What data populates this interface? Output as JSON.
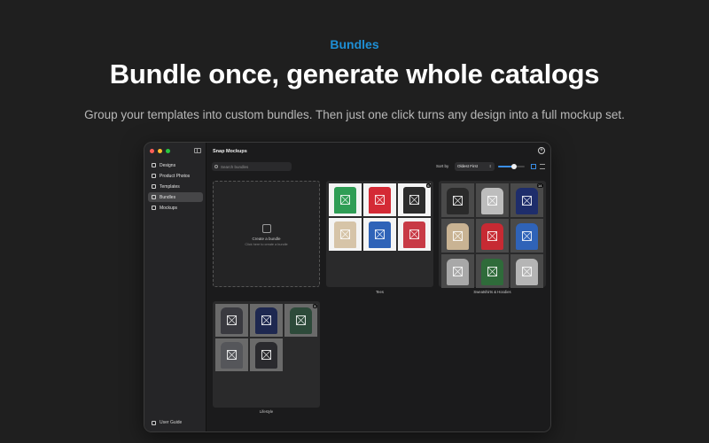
{
  "hero": {
    "eyebrow": "Bundles",
    "headline": "Bundle once, generate whole catalogs",
    "subline": "Group your templates into custom bundles. Then just one click turns any design into a full mockup set."
  },
  "window": {
    "title": "Snap Mockups",
    "add_icon": "plus-circle-icon"
  },
  "sidebar": {
    "items": [
      {
        "label": "Designs",
        "icon": "designs-icon",
        "active": false
      },
      {
        "label": "Product Photos",
        "icon": "shirt-icon",
        "active": false
      },
      {
        "label": "Templates",
        "icon": "templates-icon",
        "active": false
      },
      {
        "label": "Bundles",
        "icon": "bundles-icon",
        "active": true
      },
      {
        "label": "Mockups",
        "icon": "mockups-icon",
        "active": false
      }
    ],
    "footer": "User Guide"
  },
  "toolbar": {
    "search_placeholder": "Search bundles",
    "sort_label": "Sort by",
    "sort_value": "Oldest First",
    "thumb_size_level": 0.6
  },
  "bundles": {
    "create_title": "Create a bundle",
    "create_sub": "Click here to create a bundle",
    "cards": [
      {
        "label": "Tees",
        "count": "6",
        "colors": [
          "#2f9d55",
          "#d42a35",
          "#2c2c2c",
          "#d6c4a8",
          "#2f63b8",
          "#c83a45"
        ]
      },
      {
        "label": "Sweatshirts & Hoodies",
        "count": "14",
        "colors": [
          "#2a2a2a",
          "#bdbdbd",
          "#1e2d6b",
          "#c9b393",
          "#c72a33",
          "#2f63b8",
          "#a8a8a8",
          "#2f6b3a",
          "#b5b5b5"
        ]
      },
      {
        "label": "Lifestyle",
        "count": "5",
        "colors": [
          "#3a3a40",
          "#1e2850",
          "#2d4a3a",
          "#55565a",
          "#2a2a2e"
        ]
      }
    ]
  },
  "colors": {
    "accent": "#1e8fd6",
    "background": "#1f1f1f"
  }
}
